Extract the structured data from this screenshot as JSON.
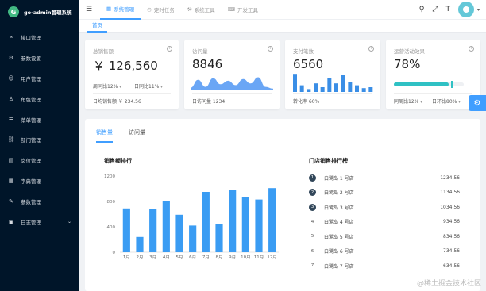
{
  "brand": {
    "logo_letter": "G",
    "title": "go-admin管理系统"
  },
  "sidebar": {
    "items": [
      {
        "label": "接口管理",
        "icon": "api-icon"
      },
      {
        "label": "参数设置",
        "icon": "settings-icon"
      },
      {
        "label": "用户管理",
        "icon": "user-icon"
      },
      {
        "label": "角色管理",
        "icon": "role-icon"
      },
      {
        "label": "菜单管理",
        "icon": "menu-icon"
      },
      {
        "label": "部门管理",
        "icon": "department-icon"
      },
      {
        "label": "岗位管理",
        "icon": "post-icon"
      },
      {
        "label": "字典管理",
        "icon": "dictionary-icon"
      },
      {
        "label": "参数管理",
        "icon": "params-icon"
      },
      {
        "label": "日志管理",
        "icon": "log-icon",
        "expandable": true
      }
    ]
  },
  "topbar": {
    "tabs": [
      {
        "label": "系统管理",
        "active": true
      },
      {
        "label": "定时任务",
        "active": false
      },
      {
        "label": "系统工具",
        "active": false
      },
      {
        "label": "开发工具",
        "active": false
      }
    ]
  },
  "subbar": {
    "tab": "首页"
  },
  "cards": {
    "sales": {
      "title": "总销售额",
      "value": "￥ 126,560",
      "week_label": "周同比",
      "week_value": "12%",
      "day_label": "日同比",
      "day_value": "11%",
      "footer": "日均销售额 ￥ 234.56"
    },
    "visits": {
      "title": "访问量",
      "value": "8846",
      "footer": "日访问量 1234"
    },
    "payments": {
      "title": "支付笔数",
      "value": "6560",
      "footer": "转化率 60%"
    },
    "operations": {
      "title": "运营活动效果",
      "value": "78%",
      "progress": 0.78,
      "week_label": "同周比",
      "week_value": "12%",
      "day_label": "日环比",
      "day_value": "80%"
    }
  },
  "panel": {
    "tabs": [
      {
        "label": "销售量",
        "active": true
      },
      {
        "label": "访问量",
        "active": false
      }
    ],
    "chart_title": "销售额排行",
    "rank_title": "门店销售排行榜",
    "ranking": [
      {
        "rank": "1",
        "name": "白鹭岛 1 号店",
        "value": "1234.56"
      },
      {
        "rank": "2",
        "name": "白鹭岛 2 号店",
        "value": "1134.56"
      },
      {
        "rank": "3",
        "name": "白鹭岛 3 号店",
        "value": "1034.56"
      },
      {
        "rank": "4",
        "name": "白鹭岛 4 号店",
        "value": "934.56"
      },
      {
        "rank": "5",
        "name": "白鹭岛 5 号店",
        "value": "834.56"
      },
      {
        "rank": "6",
        "name": "白鹭岛 6 号店",
        "value": "734.56"
      },
      {
        "rank": "7",
        "name": "白鹭岛 7 号店",
        "value": "634.56"
      }
    ]
  },
  "watermark": "@稀土掘金技术社区",
  "colors": {
    "sidebar_bg": "#001529",
    "accent": "#409eff",
    "area": "#6aa6f5",
    "progress": "#2fc1c4"
  },
  "chart_data": {
    "type": "bar",
    "title": "销售额排行",
    "categories": [
      "1月",
      "2月",
      "3月",
      "4月",
      "5月",
      "6月",
      "7月",
      "8月",
      "9月",
      "10月",
      "11月",
      "12月"
    ],
    "values": [
      690,
      240,
      680,
      800,
      590,
      420,
      950,
      440,
      980,
      870,
      830,
      1010
    ],
    "ylim": [
      0,
      1200
    ],
    "yticks": [
      "0",
      "400",
      "800",
      "1200"
    ],
    "xlabel": "",
    "ylabel": ""
  },
  "mini_charts": {
    "visits_area": [
      0.15,
      0.6,
      0.2,
      0.7,
      0.35,
      0.55,
      0.3,
      0.65,
      0.4,
      0.75,
      0.2,
      0.1
    ],
    "payments_bars": [
      0.95,
      0.35,
      0.15,
      0.45,
      0.25,
      0.75,
      0.45,
      0.9,
      0.5,
      0.35,
      0.2,
      0.25
    ]
  }
}
